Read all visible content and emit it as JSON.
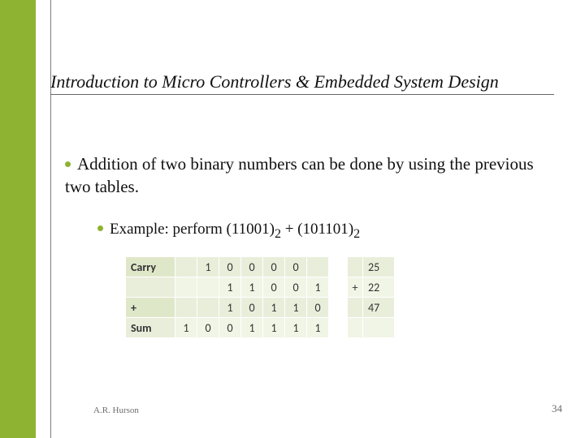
{
  "title": "Introduction to Micro Controllers & Embedded System Design",
  "main_bullet": "Addition of two binary numbers can be done by using the previous two tables.",
  "sub_bullet": {
    "prefix": "Example:  perform (",
    "a": "11001",
    "mid": ")",
    "base1": "2",
    "plus": " + (",
    "b": "101101",
    "end": ")",
    "base2": "2"
  },
  "table": {
    "rows": [
      {
        "label": "Carry",
        "cells": [
          "",
          "1",
          "0",
          "0",
          "0",
          "0",
          ""
        ],
        "op": "",
        "dec": "25"
      },
      {
        "label": "",
        "cells": [
          "",
          "",
          "1",
          "1",
          "0",
          "0",
          "1"
        ],
        "op": "+",
        "dec": "22"
      },
      {
        "label": "+",
        "cells": [
          "",
          "",
          "1",
          "0",
          "1",
          "1",
          "0"
        ],
        "op": "",
        "dec": "47"
      },
      {
        "label": "Sum",
        "cells": [
          "1",
          "0",
          "0",
          "1",
          "1",
          "1",
          "1"
        ],
        "op": "",
        "dec": ""
      }
    ]
  },
  "footer": {
    "author": "A.R. Hurson",
    "page": "34"
  }
}
